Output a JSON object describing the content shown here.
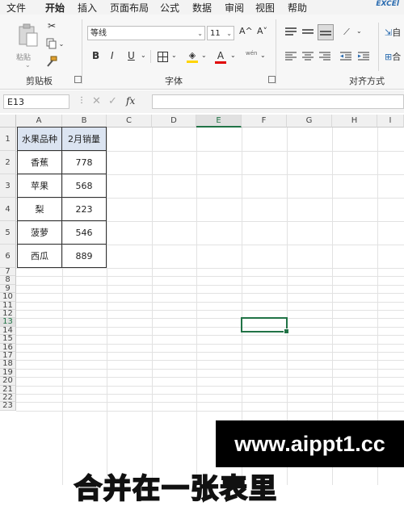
{
  "brand": "EXCEl",
  "tabs": [
    {
      "label": "文件",
      "active": false
    },
    {
      "label": "开始",
      "active": true
    },
    {
      "label": "插入",
      "active": false
    },
    {
      "label": "页面布局",
      "active": false
    },
    {
      "label": "公式",
      "active": false
    },
    {
      "label": "数据",
      "active": false
    },
    {
      "label": "审阅",
      "active": false
    },
    {
      "label": "视图",
      "active": false
    },
    {
      "label": "帮助",
      "active": false
    }
  ],
  "ribbon": {
    "clipboard": {
      "label": "剪贴板",
      "paste_label": "粘贴"
    },
    "font": {
      "label": "字体",
      "font_name": "等线",
      "font_size": "11",
      "grow_label": "A^",
      "shrink_label": "A˅",
      "bold": "B",
      "italic": "I",
      "underline": "U",
      "font_color_label": "A",
      "phonetic_label": "wén",
      "fill_color": "#ffd400",
      "font_color": "#e00000"
    },
    "alignment": {
      "label": "对齐方式",
      "wrap_label": "自",
      "merge_label": "合"
    }
  },
  "formula_bar": {
    "name_box": "E13",
    "fx_label": "fx",
    "formula": ""
  },
  "sheet": {
    "columns": [
      "A",
      "B",
      "C",
      "D",
      "E",
      "F",
      "G",
      "H",
      "I"
    ],
    "rows": [
      "1",
      "2",
      "3",
      "4",
      "5",
      "6",
      "7",
      "8",
      "9",
      "10",
      "11",
      "12",
      "13",
      "14",
      "15",
      "16",
      "17",
      "18",
      "19",
      "20",
      "21",
      "22",
      "23"
    ],
    "active_cell": "E13",
    "table": {
      "header": [
        "水果品种",
        "2月销量"
      ],
      "rows": [
        [
          "香蕉",
          "778"
        ],
        [
          "苹果",
          "568"
        ],
        [
          "梨",
          "223"
        ],
        [
          "菠萝",
          "546"
        ],
        [
          "西瓜",
          "889"
        ]
      ]
    }
  },
  "overlay": {
    "caption": "合并在一张表里",
    "watermark": "www.aippt1.cc"
  }
}
